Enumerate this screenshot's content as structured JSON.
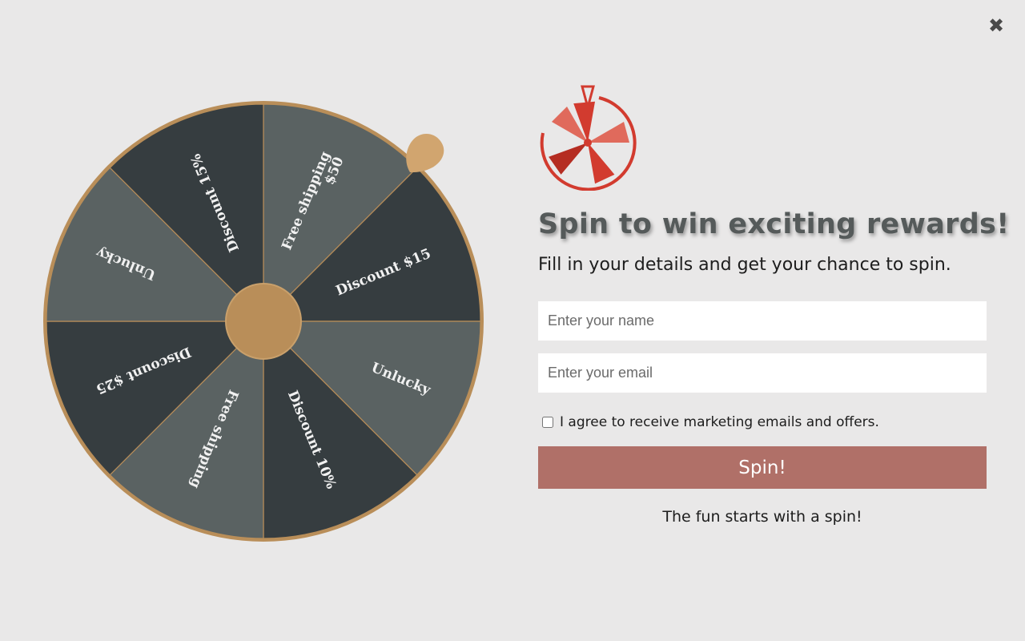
{
  "popup": {
    "close_icon": "close-icon",
    "close_glyph": "✖"
  },
  "wheel": {
    "segments": [
      {
        "label_lines": [
          "Free shipping",
          "$50"
        ],
        "color": "#5a6262"
      },
      {
        "label_lines": [
          "Discount $15"
        ],
        "color": "#363d40"
      },
      {
        "label_lines": [
          "Unlucky"
        ],
        "color": "#5a6262"
      },
      {
        "label_lines": [
          "Discount 10%"
        ],
        "color": "#363d40"
      },
      {
        "label_lines": [
          "Free shipping"
        ],
        "color": "#5a6262"
      },
      {
        "label_lines": [
          "Discount $25"
        ],
        "color": "#363d40"
      },
      {
        "label_lines": [
          "Unlucky"
        ],
        "color": "#5a6262"
      },
      {
        "label_lines": [
          "Discount 15%"
        ],
        "color": "#363d40"
      }
    ],
    "rim_color": "#b98e59",
    "hub_color": "#b98e59",
    "pointer_color": "#d1a56f",
    "label_color": "#f1f1f1"
  },
  "panel": {
    "logo_icon": "spin-wheel-logo-icon",
    "logo_color": "#d23b2f",
    "headline": "Spin to win exciting rewards!",
    "subheadline": "Fill in your details and get your chance to spin.",
    "name_placeholder": "Enter your name",
    "email_placeholder": "Enter your email",
    "consent_label": "I agree to receive marketing emails and offers.",
    "consent_checked": false,
    "spin_label": "Spin!",
    "spin_color": "#b07068",
    "footnote": "The fun starts with a spin!"
  }
}
